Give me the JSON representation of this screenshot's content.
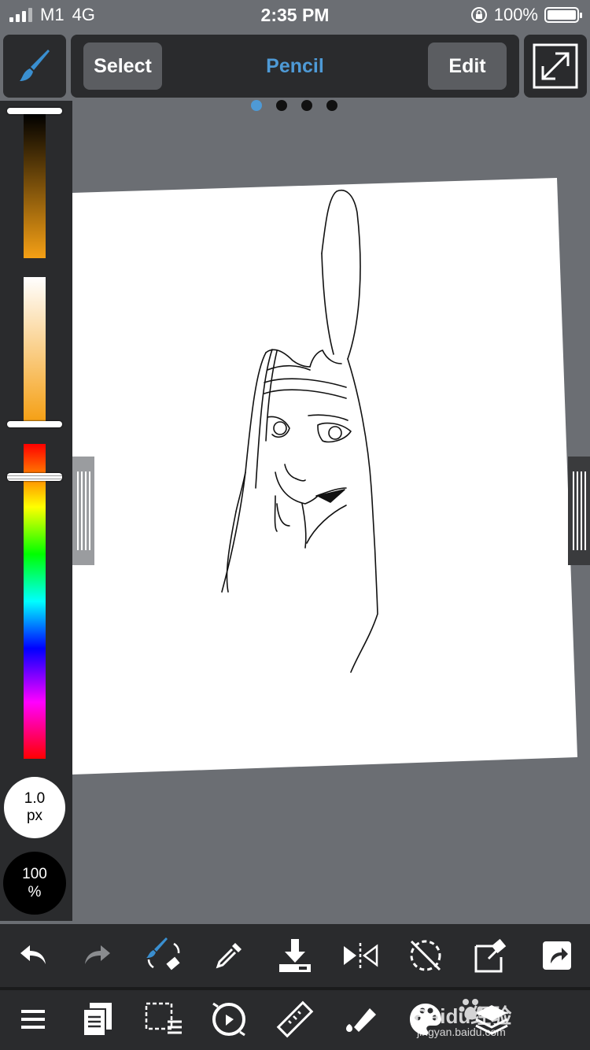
{
  "status_bar": {
    "carrier": "M1",
    "network": "4G",
    "time": "2:35 PM",
    "battery": "100%"
  },
  "toolbar": {
    "select_label": "Select",
    "mode_title": "Pencil",
    "edit_label": "Edit",
    "active_page": 1,
    "page_count": 4
  },
  "color_panel": {
    "brush_size_value": "1.0",
    "brush_size_unit": "px",
    "opacity_value": "100",
    "opacity_unit": "%",
    "current_color": "#f5a015",
    "accent": "#4e9ad6"
  },
  "bottom_toolbar_1": {
    "icons": [
      "undo-icon",
      "redo-icon",
      "brush-eraser-swap-icon",
      "eyedropper-icon",
      "save-icon",
      "flip-icon",
      "rotate-lock-icon",
      "clear-edit-icon",
      "share-icon"
    ]
  },
  "bottom_toolbar_2": {
    "icons": [
      "menu-icon",
      "pages-icon",
      "selection-icon",
      "snap-icon",
      "ruler-icon",
      "fill-icon",
      "palette-icon",
      "layers-icon"
    ]
  },
  "watermark": {
    "text": "Baidu经验",
    "subtext": "jingyan.baidu.com"
  }
}
